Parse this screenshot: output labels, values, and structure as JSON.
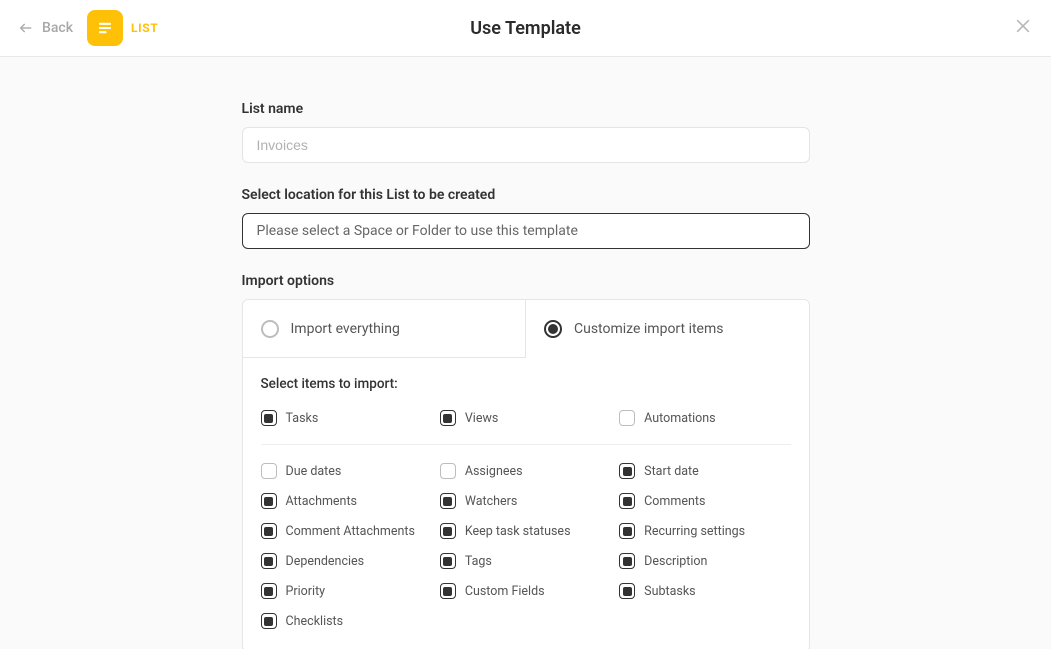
{
  "header": {
    "back_label": "Back",
    "chip_label": "LIST",
    "title": "Use Template"
  },
  "form": {
    "list_name_label": "List name",
    "list_name_placeholder": "Invoices",
    "location_label": "Select location for this List to be created",
    "location_placeholder": "Please select a Space or Folder to use this template",
    "import_options_label": "Import options",
    "import_tab_everything": "Import everything",
    "import_tab_customize": "Customize import items",
    "select_items_label": "Select items to import:"
  },
  "top_items": [
    {
      "label": "Tasks",
      "checked": true
    },
    {
      "label": "Views",
      "checked": true
    },
    {
      "label": "Automations",
      "checked": false
    }
  ],
  "items": [
    {
      "label": "Due dates",
      "checked": false
    },
    {
      "label": "Assignees",
      "checked": false
    },
    {
      "label": "Start date",
      "checked": true
    },
    {
      "label": "Attachments",
      "checked": true
    },
    {
      "label": "Watchers",
      "checked": true
    },
    {
      "label": "Comments",
      "checked": true
    },
    {
      "label": "Comment Attachments",
      "checked": true
    },
    {
      "label": "Keep task statuses",
      "checked": true
    },
    {
      "label": "Recurring settings",
      "checked": true
    },
    {
      "label": "Dependencies",
      "checked": true
    },
    {
      "label": "Tags",
      "checked": true
    },
    {
      "label": "Description",
      "checked": true
    },
    {
      "label": "Priority",
      "checked": true
    },
    {
      "label": "Custom Fields",
      "checked": true
    },
    {
      "label": "Subtasks",
      "checked": true
    },
    {
      "label": "Checklists",
      "checked": true
    }
  ]
}
